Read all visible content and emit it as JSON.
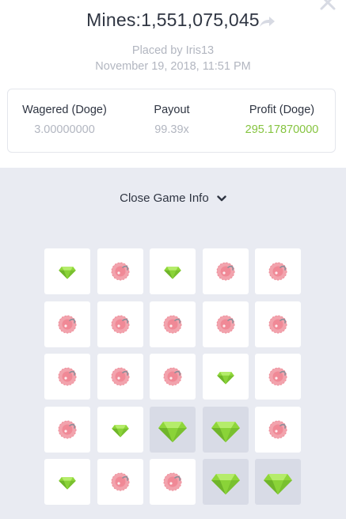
{
  "header": {
    "title": "Mines:1,551,075,045",
    "placed_by": "Placed by Iris13",
    "timestamp": "November 19, 2018, 11:51 PM",
    "share_icon": "share-arrow-icon",
    "close_icon": "close-icon"
  },
  "stats": {
    "wagered_label": "Wagered (Doge)",
    "wagered_value": "3.00000000",
    "payout_label": "Payout",
    "payout_value": "99.39x",
    "profit_label": "Profit (Doge)",
    "profit_value": "295.17870000"
  },
  "colors": {
    "profit": "#86c440",
    "gem": "#8fd63a",
    "mine": "#f2a3ad",
    "revealed_tile": "#d8dbe6",
    "board_bg": "#e9ebf2"
  },
  "toggle": {
    "label": "Close Game Info",
    "icon": "chevron-down-icon"
  },
  "board": {
    "rows": 5,
    "cols": 5,
    "tiles": [
      [
        "gem",
        "mine",
        "gem",
        "mine",
        "mine"
      ],
      [
        "mine",
        "mine",
        "mine",
        "mine",
        "mine"
      ],
      [
        "mine",
        "mine",
        "mine",
        "gem",
        "mine"
      ],
      [
        "mine",
        "gem",
        "gem-revealed",
        "gem-revealed",
        "mine"
      ],
      [
        "gem",
        "mine",
        "mine",
        "gem-revealed",
        "gem-revealed"
      ]
    ]
  }
}
